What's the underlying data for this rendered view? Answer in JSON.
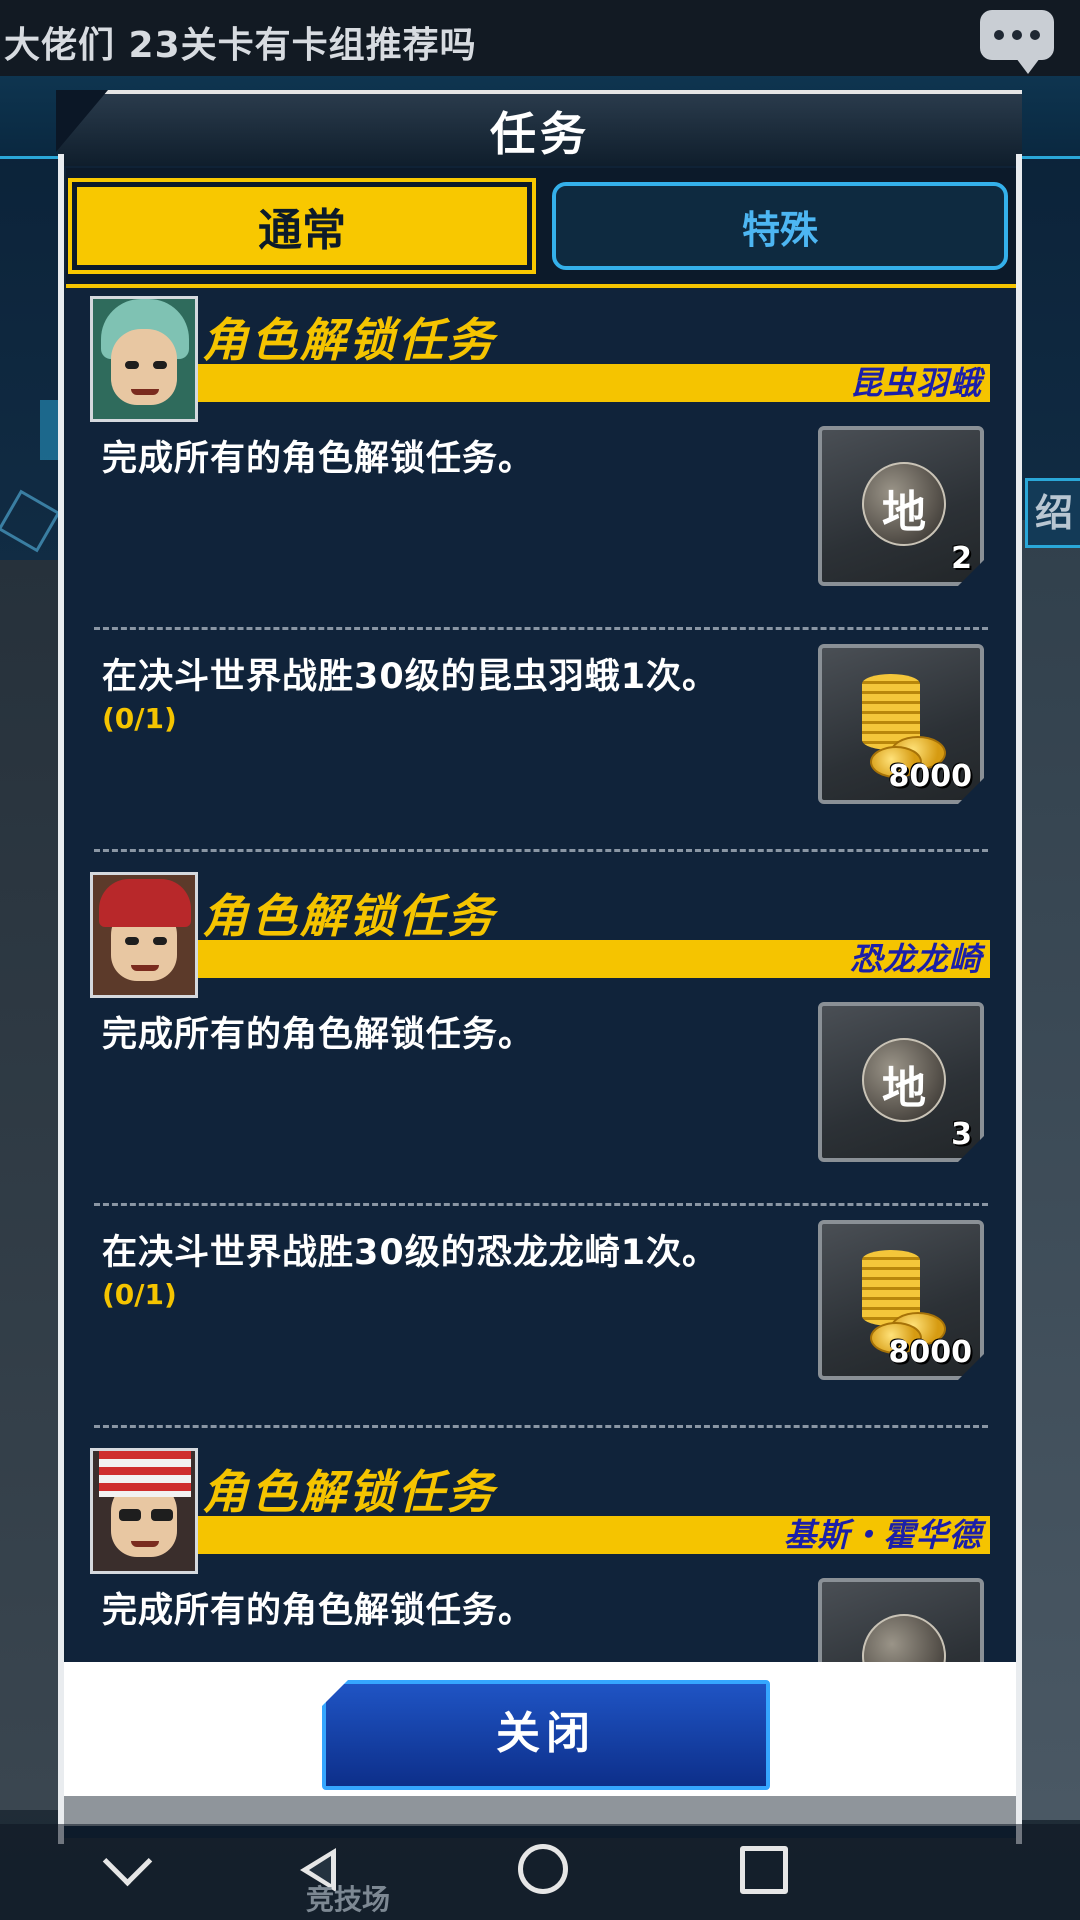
{
  "notification": {
    "text": "大佬们 23关卡有卡组推荐吗"
  },
  "background": {
    "side_label": "绍",
    "bottom_label": "竞技场"
  },
  "modal": {
    "title": "任务",
    "tabs": [
      {
        "label": "通常",
        "active": true
      },
      {
        "label": "特殊",
        "active": false
      }
    ],
    "groups": [
      {
        "title": "角色解锁任务",
        "character": "昆虫羽蛾",
        "tasks": [
          {
            "description": "完成所有的角色解锁任务。",
            "progress": "",
            "reward": {
              "type": "orb",
              "icon": "earth-orb-icon",
              "glyph": "地",
              "quantity": "2"
            }
          },
          {
            "description": "在决斗世界战胜30级的昆虫羽蛾1次。",
            "progress": "(0/1)",
            "reward": {
              "type": "coins",
              "icon": "gold-coins-icon",
              "quantity": "8000"
            }
          }
        ]
      },
      {
        "title": "角色解锁任务",
        "character": "恐龙龙崎",
        "tasks": [
          {
            "description": "完成所有的角色解锁任务。",
            "progress": "",
            "reward": {
              "type": "orb",
              "icon": "earth-orb-icon",
              "glyph": "地",
              "quantity": "3"
            }
          },
          {
            "description": "在决斗世界战胜30级的恐龙龙崎1次。",
            "progress": "(0/1)",
            "reward": {
              "type": "coins",
              "icon": "gold-coins-icon",
              "quantity": "8000"
            }
          }
        ]
      },
      {
        "title": "角色解锁任务",
        "character": "基斯・霍华德",
        "tasks": [
          {
            "description": "完成所有的角色解锁任务。",
            "progress": "",
            "reward": {
              "type": "orb",
              "icon": "reward-icon",
              "glyph": "",
              "quantity": ""
            }
          }
        ]
      }
    ],
    "close_label": "关闭"
  },
  "colors": {
    "accent_yellow": "#f5c400",
    "tab_blue": "#34b0ea",
    "button_blue": "#1f54c4",
    "panel_bg": "#10233a"
  }
}
